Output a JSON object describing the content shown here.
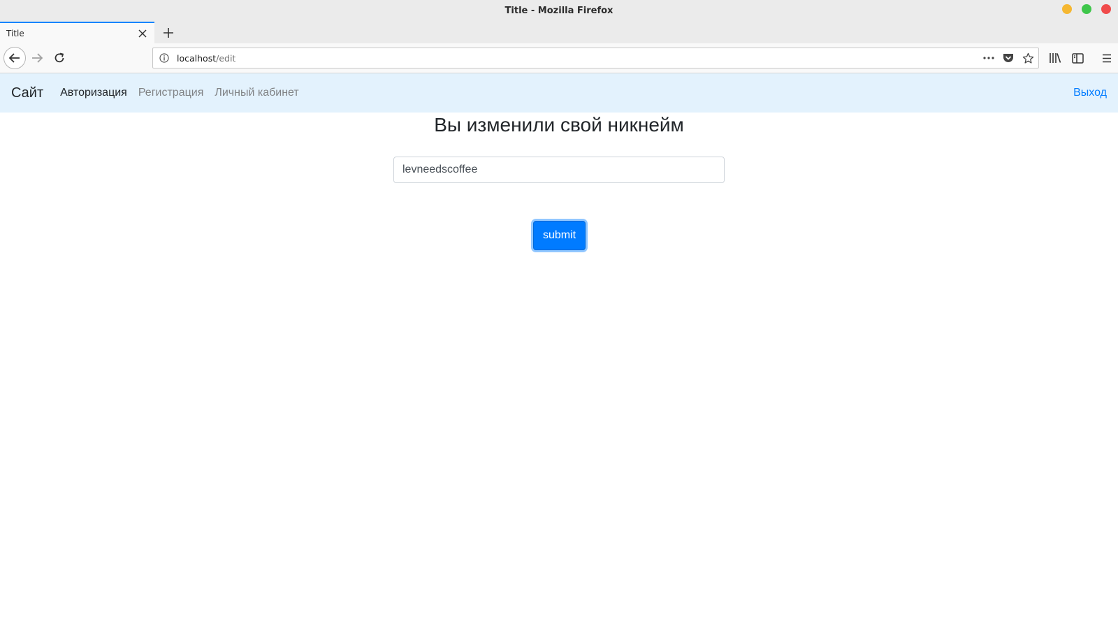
{
  "window": {
    "title": "Title - Mozilla Firefox"
  },
  "tabs": [
    {
      "label": "Title",
      "active": true
    }
  ],
  "address_bar": {
    "host": "localhost",
    "path": "/edit"
  },
  "icons": {
    "back": "back-arrow-icon",
    "forward": "forward-arrow-icon",
    "reload": "reload-icon",
    "info": "info-icon",
    "page_actions": "more-icon",
    "pocket": "pocket-icon",
    "bookmark": "star-icon",
    "library": "library-icon",
    "sidebar": "sidebar-icon",
    "menu": "hamburger-menu-icon",
    "tab_close": "close-icon",
    "new_tab": "plus-icon"
  },
  "navbar": {
    "brand": "Сайт",
    "links": [
      {
        "label": "Авторизация",
        "state": "active"
      },
      {
        "label": "Регистрация",
        "state": "muted"
      },
      {
        "label": "Личный кабинет",
        "state": "muted"
      }
    ],
    "logout": "Выход"
  },
  "main": {
    "heading": "Вы изменили свой никнейм",
    "nickname_value": "levneedscoffee",
    "submit_label": "submit"
  },
  "colors": {
    "navbar_bg": "#e3f2fd",
    "primary": "#007bff",
    "tab_accent": "#0a84ff"
  }
}
